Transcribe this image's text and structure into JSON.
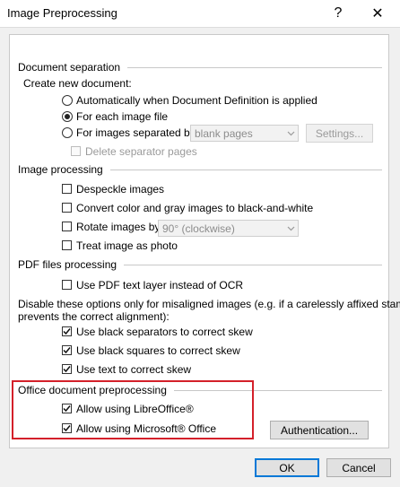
{
  "window": {
    "title": "Image Preprocessing",
    "help": "?",
    "close": "✕"
  },
  "doc_sep": {
    "header": "Document separation",
    "create_label": "Create new document:",
    "radio_auto": "Automatically when Document Definition is applied",
    "radio_each": "For each image file",
    "radio_separated": "For images separated by",
    "separator_value": "blank pages",
    "settings_btn": "Settings...",
    "delete_sep": "Delete separator pages",
    "selected": "each"
  },
  "img_proc": {
    "header": "Image processing",
    "despeckle": "Despeckle images",
    "convert": "Convert color and gray images to black-and-white",
    "rotate": "Rotate images by",
    "rotate_value": "90° (clockwise)",
    "photo": "Treat image as photo"
  },
  "pdf": {
    "header": "PDF files processing",
    "text_layer": "Use PDF text layer instead of OCR"
  },
  "misaligned": {
    "line1": "Disable these options only for misaligned images (e.g. if a carelessly affixed stamp",
    "line2": "prevents the correct alignment):",
    "black_sep": "Use black separators to correct skew",
    "black_sq": "Use black squares to correct skew",
    "text_skew": "Use text to correct skew"
  },
  "office": {
    "header": "Office document preprocessing",
    "libre": "Allow using LibreOffice®",
    "ms": "Allow using Microsoft® Office",
    "auth_btn": "Authentication..."
  },
  "footer": {
    "ok": "OK",
    "cancel": "Cancel"
  },
  "colors": {
    "highlight": "#d4202a",
    "default_button_border": "#0078d7"
  }
}
